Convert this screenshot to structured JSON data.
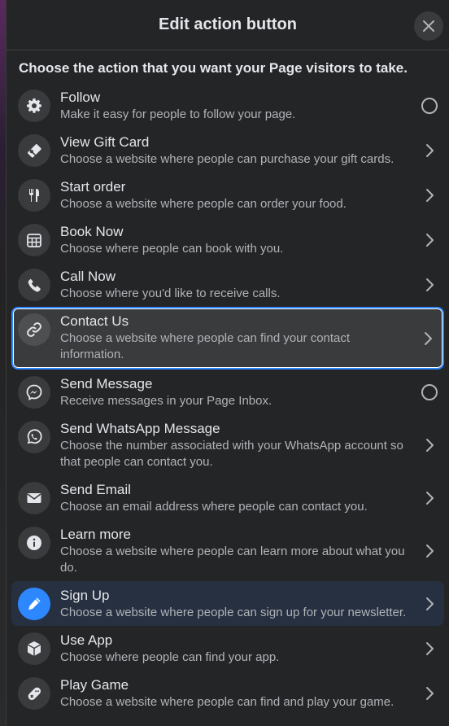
{
  "dialog": {
    "title": "Edit action button",
    "subtitle": "Choose the action that you want your Page visitors to take."
  },
  "items": [
    {
      "title": "Follow",
      "desc": "Make it easy for people to follow your page.",
      "icon": "gear-icon",
      "trail": "radio"
    },
    {
      "title": "View Gift Card",
      "desc": "Choose a website where people can purchase your gift cards.",
      "icon": "gift-card-icon",
      "trail": "chevron"
    },
    {
      "title": "Start order",
      "desc": "Choose a website where people can order your food.",
      "icon": "fork-knife-icon",
      "trail": "chevron"
    },
    {
      "title": "Book Now",
      "desc": "Choose where people can book with you.",
      "icon": "calendar-icon",
      "trail": "chevron"
    },
    {
      "title": "Call Now",
      "desc": "Choose where you'd like to receive calls.",
      "icon": "phone-icon",
      "trail": "chevron"
    },
    {
      "title": "Contact Us",
      "desc": "Choose a website where people can find your contact information.",
      "icon": "link-icon",
      "trail": "chevron",
      "selected": true
    },
    {
      "title": "Send Message",
      "desc": "Receive messages in your Page Inbox.",
      "icon": "messenger-icon",
      "trail": "radio"
    },
    {
      "title": "Send WhatsApp Message",
      "desc": "Choose the number associated with your WhatsApp account so that people can contact you.",
      "icon": "whatsapp-icon",
      "trail": "chevron"
    },
    {
      "title": "Send Email",
      "desc": "Choose an email address where people can contact you.",
      "icon": "envelope-icon",
      "trail": "chevron"
    },
    {
      "title": "Learn more",
      "desc": "Choose a website where people can learn more about what you do.",
      "icon": "info-icon",
      "trail": "chevron"
    },
    {
      "title": "Sign Up",
      "desc": "Choose a website where people can sign up for your newsletter.",
      "icon": "pencil-icon",
      "trail": "chevron",
      "hover": true
    },
    {
      "title": "Use App",
      "desc": "Choose where people can find your app.",
      "icon": "box-icon",
      "trail": "chevron"
    },
    {
      "title": "Play Game",
      "desc": "Choose a website where people can find and play your game.",
      "icon": "gamepad-icon",
      "trail": "chevron"
    }
  ],
  "colors": {
    "accent": "#2d88ff",
    "surface": "#242526",
    "text_primary": "#e4e6eb",
    "text_secondary": "#b0b3b8"
  }
}
